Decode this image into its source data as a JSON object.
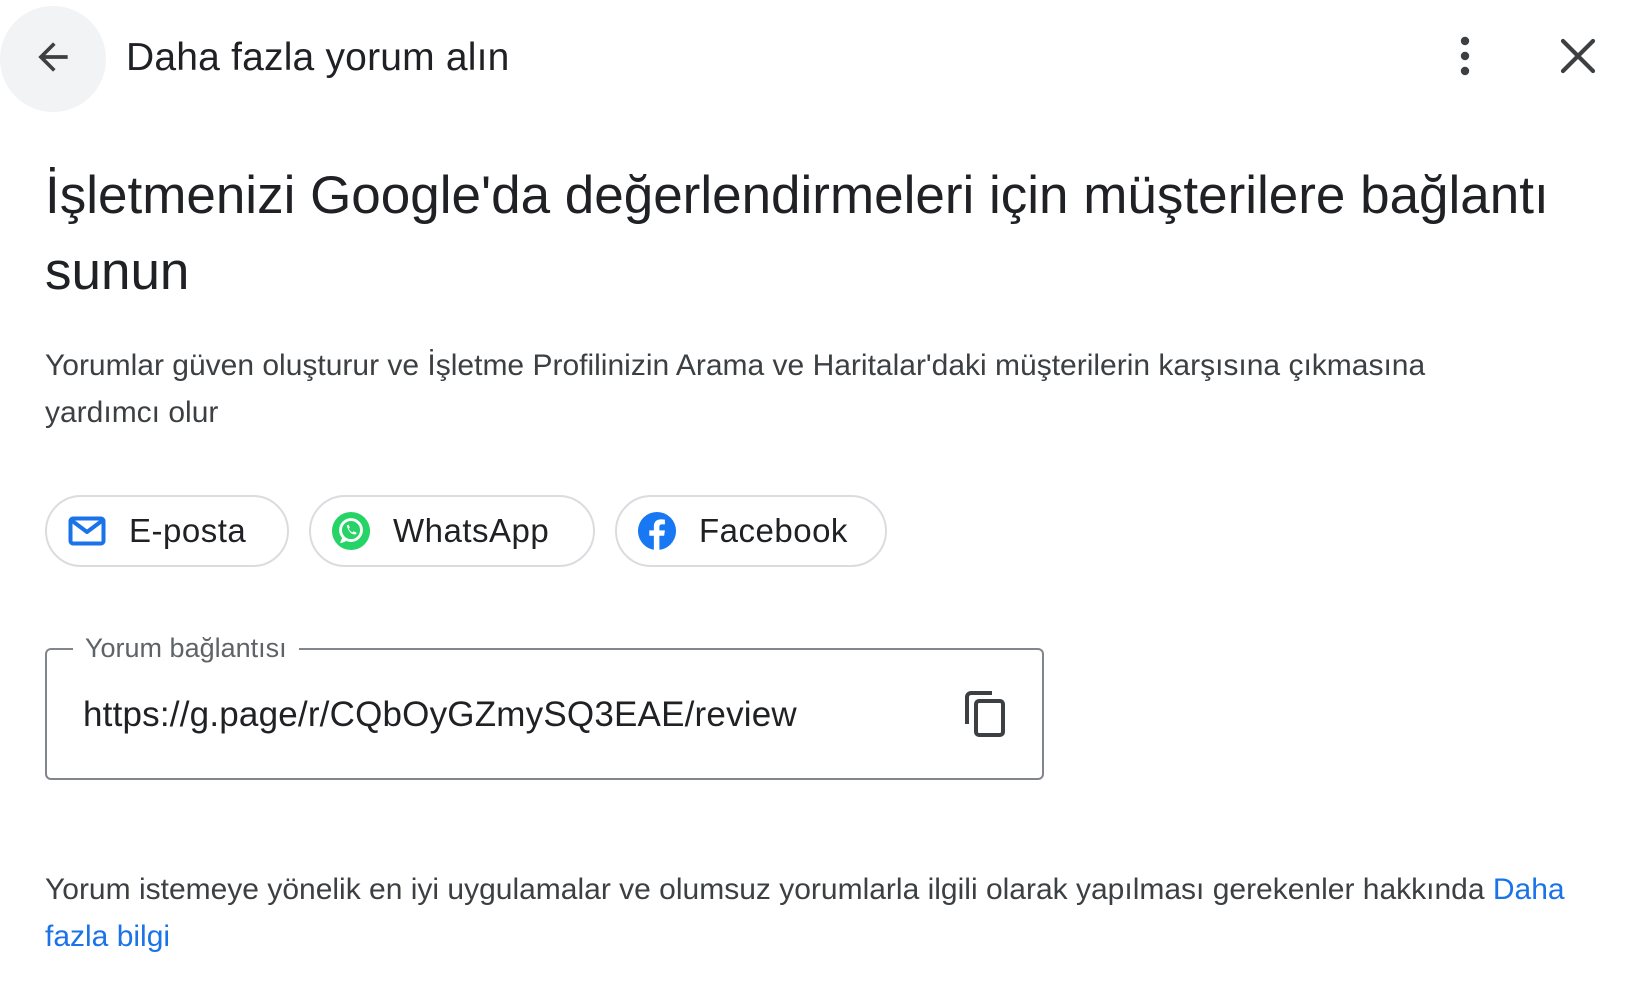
{
  "header": {
    "title": "Daha fazla yorum alın",
    "back_icon": "arrow-back-icon",
    "more_icon": "more-vert-icon",
    "close_icon": "close-icon"
  },
  "main": {
    "heading": "İşletmenizi Google'da değerlendirmeleri için müşterilere bağlantı sunun",
    "description": "Yorumlar güven oluşturur ve İşletme Profilinizin Arama ve Haritalar'daki müşterilerin karşısına çıkmasına yardımcı olur"
  },
  "share_options": [
    {
      "label": "E-posta",
      "icon": "mail-icon"
    },
    {
      "label": "WhatsApp",
      "icon": "whatsapp-icon"
    },
    {
      "label": "Facebook",
      "icon": "facebook-icon"
    }
  ],
  "review_link": {
    "label": "Yorum bağlantısı",
    "value": "https://g.page/r/CQbOyGZmySQ3EAE/review",
    "copy_icon": "copy-icon"
  },
  "footer": {
    "text": "Yorum istemeye yönelik en iyi uygulamalar ve olumsuz yorumlarla ilgili olarak yapılması gerekenler hakkında",
    "link_label": "Daha fazla bilgi"
  },
  "colors": {
    "link": "#1a73e8",
    "whatsapp": "#25d366",
    "facebook": "#1877f2",
    "email": "#1a73e8"
  }
}
